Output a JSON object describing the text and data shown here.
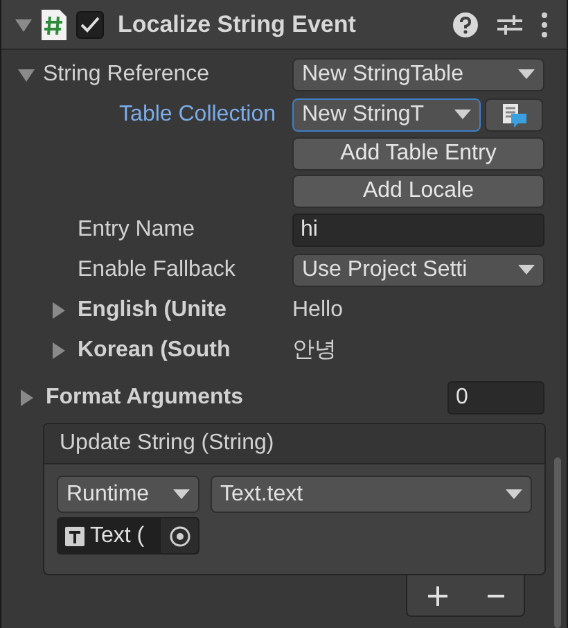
{
  "component": {
    "title": "Localize String Event",
    "enabled": true,
    "expanded": true
  },
  "string_reference": {
    "label": "String Reference",
    "value": "New StringTable",
    "expanded": true
  },
  "table_collection": {
    "label": "Table Collection",
    "value": "New StringT"
  },
  "buttons": [
    "Add Table Entry",
    "Add Locale"
  ],
  "entry_name": {
    "label": "Entry Name",
    "value": "hi"
  },
  "enable_fallback": {
    "label": "Enable Fallback",
    "value": "Use Project Setti"
  },
  "locales": [
    {
      "name": "English (Unite",
      "value": "Hello",
      "expanded": false
    },
    {
      "name": "Korean (South",
      "value": "안녕",
      "expanded": false
    }
  ],
  "format_arguments": {
    "label": "Format Arguments",
    "value": "0",
    "expanded": false
  },
  "event": {
    "title": "Update String (String)",
    "mode": "Runtime",
    "function": "Text.text",
    "target": "Text ("
  }
}
